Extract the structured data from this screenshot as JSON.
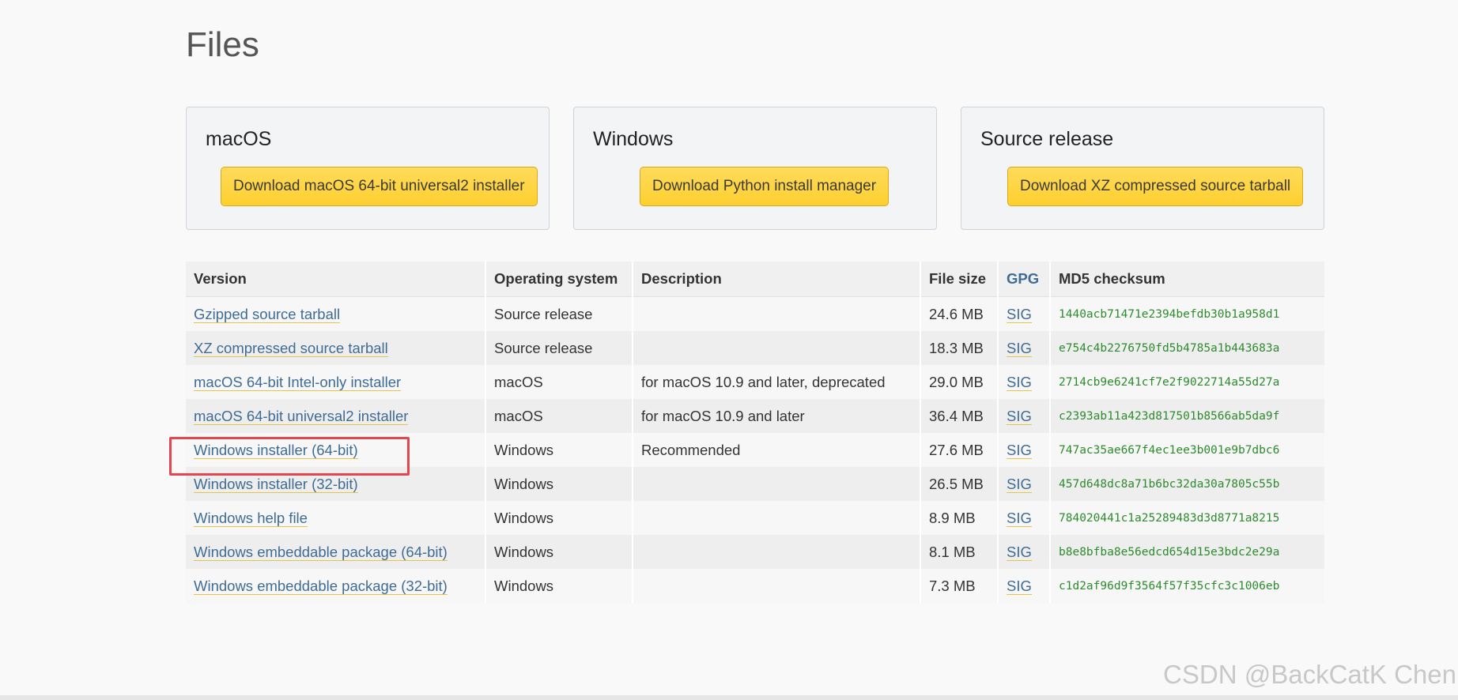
{
  "page": {
    "title": "Files"
  },
  "cards": [
    {
      "heading": "macOS",
      "button_label": "Download macOS 64-bit universal2 installer"
    },
    {
      "heading": "Windows",
      "button_label": "Download Python install manager"
    },
    {
      "heading": "Source release",
      "button_label": "Download XZ compressed source tarball"
    }
  ],
  "table": {
    "headers": {
      "version": "Version",
      "os": "Operating system",
      "description": "Description",
      "file_size": "File size",
      "gpg": "GPG",
      "md5": "MD5 checksum"
    },
    "rows": [
      {
        "version": "Gzipped source tarball",
        "os": "Source release",
        "description": "",
        "size": "24.6 MB",
        "sig": "SIG",
        "md5": "1440acb71471e2394befdb30b1a958d1"
      },
      {
        "version": "XZ compressed source tarball",
        "os": "Source release",
        "description": "",
        "size": "18.3 MB",
        "sig": "SIG",
        "md5": "e754c4b2276750fd5b4785a1b443683a"
      },
      {
        "version": "macOS 64-bit Intel-only installer",
        "os": "macOS",
        "description": "for macOS 10.9 and later, deprecated",
        "size": "29.0 MB",
        "sig": "SIG",
        "md5": "2714cb9e6241cf7e2f9022714a55d27a"
      },
      {
        "version": "macOS 64-bit universal2 installer",
        "os": "macOS",
        "description": "for macOS 10.9 and later",
        "size": "36.4 MB",
        "sig": "SIG",
        "md5": "c2393ab11a423d817501b8566ab5da9f"
      },
      {
        "version": "Windows installer (64-bit)",
        "os": "Windows",
        "description": "Recommended",
        "size": "27.6 MB",
        "sig": "SIG",
        "md5": "747ac35ae667f4ec1ee3b001e9b7dbc6"
      },
      {
        "version": "Windows installer (32-bit)",
        "os": "Windows",
        "description": "",
        "size": "26.5 MB",
        "sig": "SIG",
        "md5": "457d648dc8a71b6bc32da30a7805c55b"
      },
      {
        "version": "Windows help file",
        "os": "Windows",
        "description": "",
        "size": "8.9 MB",
        "sig": "SIG",
        "md5": "784020441c1a25289483d3d8771a8215"
      },
      {
        "version": "Windows embeddable package (64-bit)",
        "os": "Windows",
        "description": "",
        "size": "8.1 MB",
        "sig": "SIG",
        "md5": "b8e8bfba8e56edcd654d15e3bdc2e29a"
      },
      {
        "version": "Windows embeddable package (32-bit)",
        "os": "Windows",
        "description": "",
        "size": "7.3 MB",
        "sig": "SIG",
        "md5": "c1d2af96d9f3564f57f35cfc3c1006eb"
      }
    ]
  },
  "watermark": "CSDN @BackCatK Chen",
  "colors": {
    "button_yellow": "#fed33b",
    "link_blue": "#3f6c94",
    "md5_green": "#2e8b2e",
    "highlight_red": "#e5454f"
  }
}
